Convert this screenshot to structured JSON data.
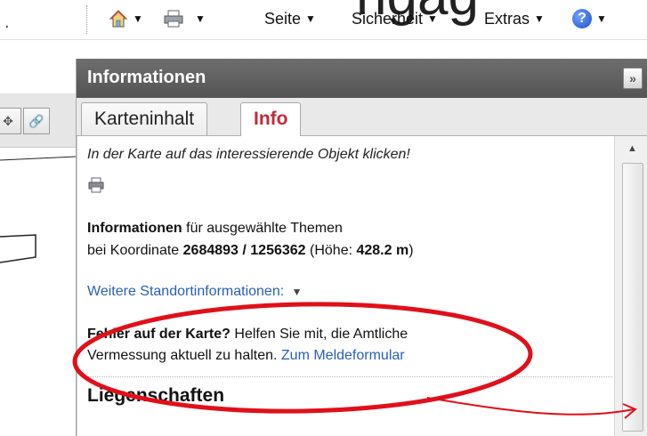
{
  "toolbar": {
    "big_text": "ngag",
    "left_dot": ".",
    "items": [
      {
        "label": "Seite"
      },
      {
        "label": "Sicherheit"
      },
      {
        "label": "Extras"
      }
    ],
    "help_label": "?"
  },
  "panel": {
    "title": "Informationen",
    "collapse_label": "»",
    "tabs": [
      {
        "label": "Karteninhalt"
      },
      {
        "label": "Info"
      }
    ]
  },
  "info": {
    "hint": "In der Karte auf das interessierende Objekt klicken!",
    "line1_bold": "Informationen",
    "line1_rest": " für ausgewählte Themen",
    "line2_prefix": "bei Koordinate ",
    "coordinate": "2684893 / 1256362",
    "line2_mid": " (Höhe: ",
    "height": "428.2 m",
    "line2_end": ")",
    "more_link": "Weitere Standortinformationen:",
    "error_bold": "Fehler auf der Karte?",
    "error_rest": " Helfen Sie mit, die Amtliche",
    "error_line2": "Vermessung aktuell zu halten. ",
    "report_link": "Zum Meldeformular",
    "section": "Liegenschaften"
  },
  "colors": {
    "accent_tab": "#c22a3a",
    "link": "#2a5fb7",
    "annotation": "#e0101a",
    "panel_header": "#5e5e5e"
  }
}
